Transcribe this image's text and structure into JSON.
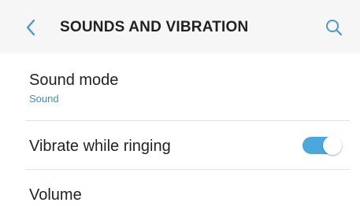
{
  "header": {
    "title": "SOUNDS AND VIBRATION",
    "back_icon": "chevron-left-icon",
    "search_icon": "search-icon",
    "accent_color": "#4aa8dc"
  },
  "settings": {
    "sound_mode": {
      "label": "Sound mode",
      "value": "Sound"
    },
    "vibrate_while_ringing": {
      "label": "Vibrate while ringing",
      "enabled": true
    },
    "volume": {
      "label": "Volume"
    }
  }
}
